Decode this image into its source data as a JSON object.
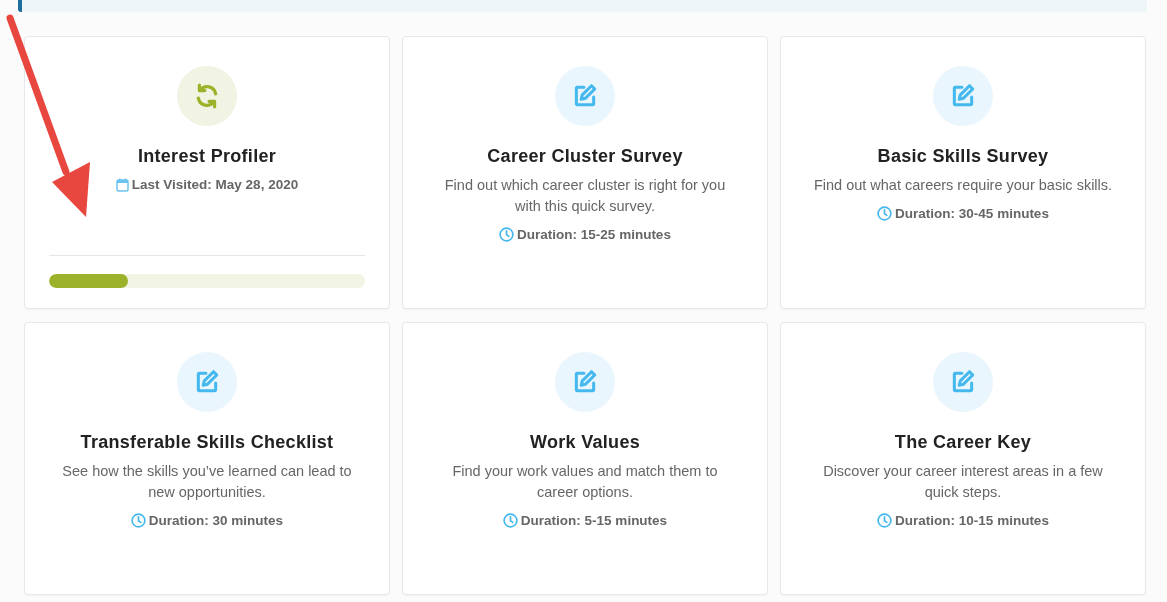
{
  "cards": [
    {
      "kind": "progress",
      "title": "Interest Profiler",
      "last_visited": "Last Visited: May 28, 2020",
      "level": 0.25
    },
    {
      "kind": "survey",
      "title": "Career Cluster Survey",
      "description": "Find out which career cluster is right for you with this quick survey.",
      "duration": "Duration: 15-25 minutes"
    },
    {
      "kind": "survey",
      "title": "Basic Skills Survey",
      "description": "Find out what careers require your basic skills.",
      "duration": "Duration: 30-45 minutes"
    },
    {
      "kind": "survey",
      "title": "Transferable Skills Checklist",
      "description": "See how the skills you’ve learned can lead to new opportunities.",
      "duration": "Duration: 30 minutes"
    },
    {
      "kind": "survey",
      "title": "Work Values",
      "description": "Find your work values and match them to career options.",
      "duration": "Duration: 5-15 minutes"
    },
    {
      "kind": "survey",
      "title": "The Career Key",
      "description": "Discover your career interest areas in a few quick steps.",
      "duration": "Duration: 10-15 minutes"
    }
  ]
}
